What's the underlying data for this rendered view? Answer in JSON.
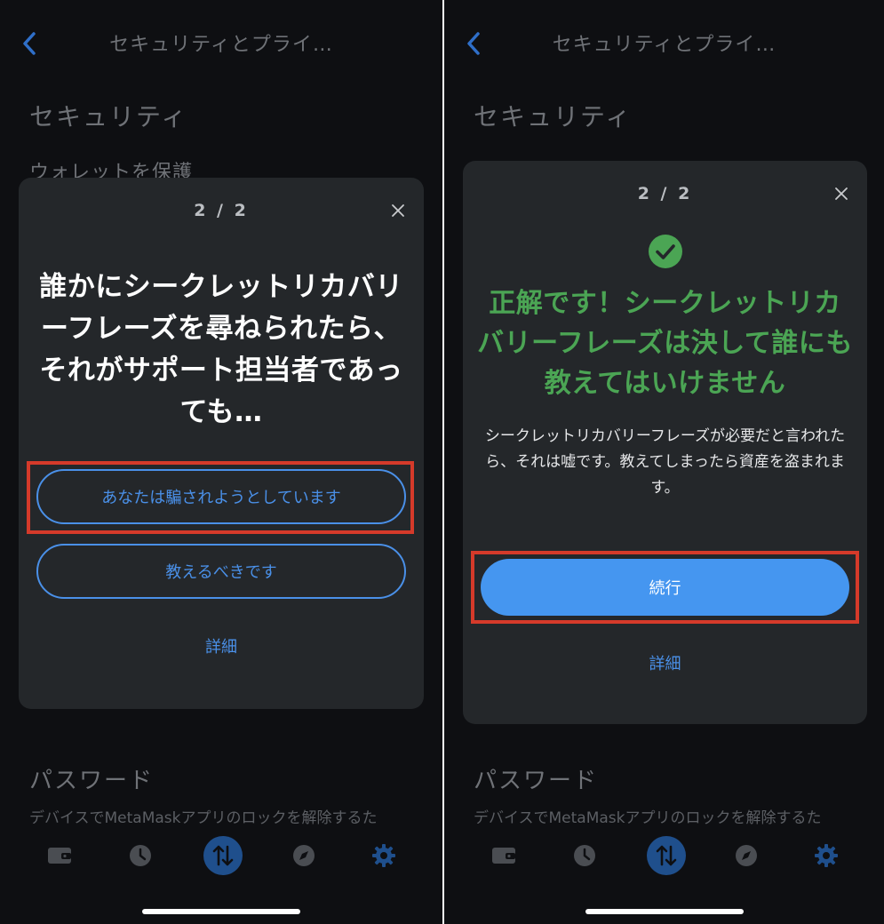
{
  "left_screen": {
    "header": {
      "title": "セキュリティとプライ…"
    },
    "section": {
      "title": "セキュリティ",
      "subtitle": "ウォレットを保護"
    },
    "modal": {
      "step": "2 / 2",
      "question": "誰かにシークレットリカバリーフレーズを尋ねられたら、それがサポート担当者であっても…",
      "option_a": "あなたは騙されようとしています",
      "option_b": "教えるべきです",
      "learn_more": "詳細"
    },
    "password": {
      "title": "パスワード",
      "description": "デバイスでMetaMaskアプリのロックを解除するた"
    }
  },
  "right_screen": {
    "header": {
      "title": "セキュリティとプライ…"
    },
    "section": {
      "title": "セキュリティ"
    },
    "modal": {
      "step": "2 / 2",
      "correct_title": "正解です！シークレットリカバリーフレーズは決して誰にも教えてはいけません",
      "explanation": "シークレットリカバリーフレーズが必要だと言われたら、それは嘘です。教えてしまったら資産を盗まれます。",
      "continue": "続行",
      "learn_more": "詳細"
    },
    "password": {
      "title": "パスワード",
      "description": "デバイスでMetaMaskアプリのロックを解除するた"
    }
  },
  "tabbar": {
    "icons": [
      "wallet-icon",
      "clock-icon",
      "swap-icon",
      "compass-icon",
      "gear-icon"
    ]
  },
  "colors": {
    "background": "#0e0f12",
    "modal": "#24272a",
    "accent_blue": "#4a90e8",
    "primary_button": "#4596f0",
    "success_green": "#4ba554",
    "highlight_red": "#d53a2a"
  }
}
